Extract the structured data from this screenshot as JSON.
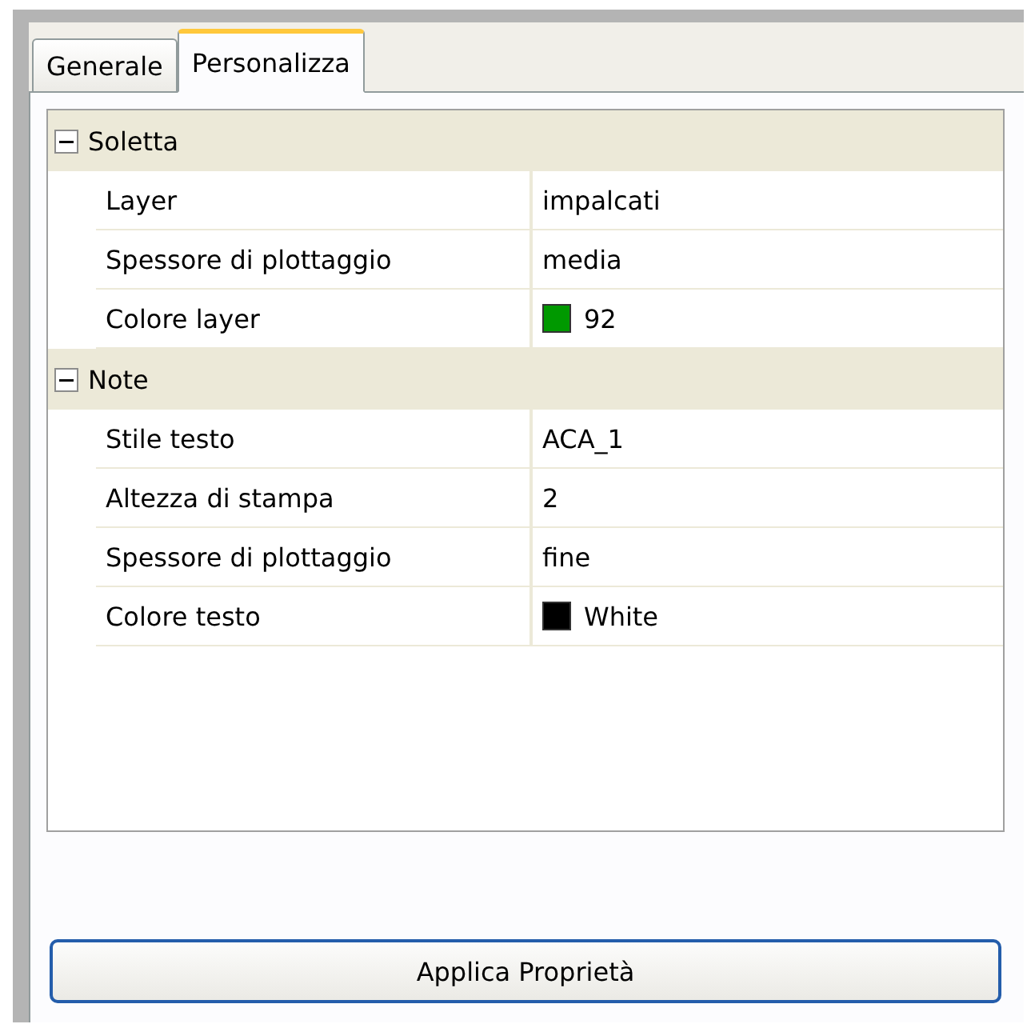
{
  "tabs": [
    {
      "label": "Generale",
      "selected": false
    },
    {
      "label": "Personalizza",
      "selected": true
    }
  ],
  "categories": [
    {
      "label": "Soletta",
      "expanded": true,
      "properties": [
        {
          "name": "Layer",
          "value": "impalcati"
        },
        {
          "name": "Spessore di plottaggio",
          "value": "media"
        },
        {
          "name": "Colore layer",
          "value": "92",
          "color": "#009900"
        }
      ]
    },
    {
      "label": "Note",
      "expanded": true,
      "properties": [
        {
          "name": "Stile testo",
          "value": "ACA_1"
        },
        {
          "name": "Altezza di stampa",
          "value": "2"
        },
        {
          "name": "Spessore di plottaggio",
          "value": "fine"
        },
        {
          "name": "Colore testo",
          "value": "White",
          "color": "#000000"
        }
      ]
    }
  ],
  "apply_button": "Applica Proprietà"
}
